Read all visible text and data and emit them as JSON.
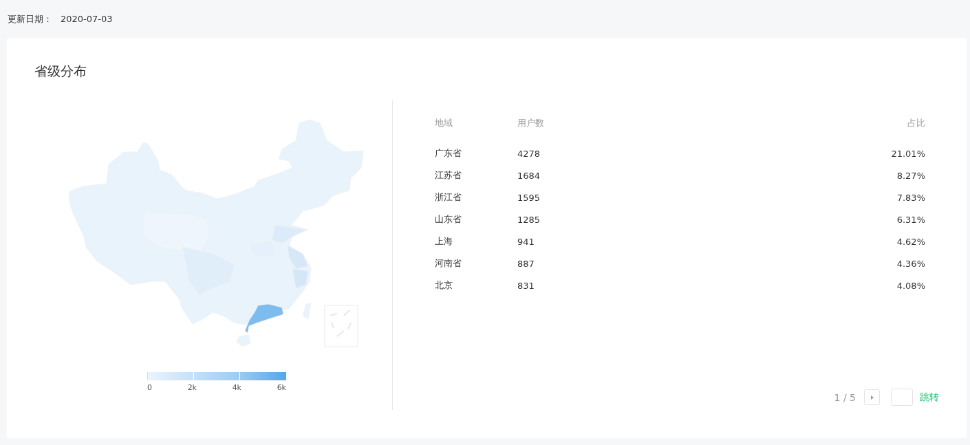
{
  "update": {
    "label": "更新日期：",
    "date": "2020-07-03"
  },
  "panel": {
    "title": "省级分布",
    "legend": {
      "labels": [
        "0",
        "2k",
        "4k",
        "6k"
      ]
    },
    "table": {
      "columns": [
        "地域",
        "用户数",
        "占比"
      ],
      "rows": [
        {
          "region": "广东省",
          "users": "4278",
          "share": "21.01%"
        },
        {
          "region": "江苏省",
          "users": "1684",
          "share": "8.27%"
        },
        {
          "region": "浙江省",
          "users": "1595",
          "share": "7.83%"
        },
        {
          "region": "山东省",
          "users": "1285",
          "share": "6.31%"
        },
        {
          "region": "上海",
          "users": "941",
          "share": "4.62%"
        },
        {
          "region": "河南省",
          "users": "887",
          "share": "4.36%"
        },
        {
          "region": "北京",
          "users": "831",
          "share": "4.08%"
        }
      ]
    },
    "pagination": {
      "page": "1 / 5",
      "jump": "跳转"
    }
  }
}
